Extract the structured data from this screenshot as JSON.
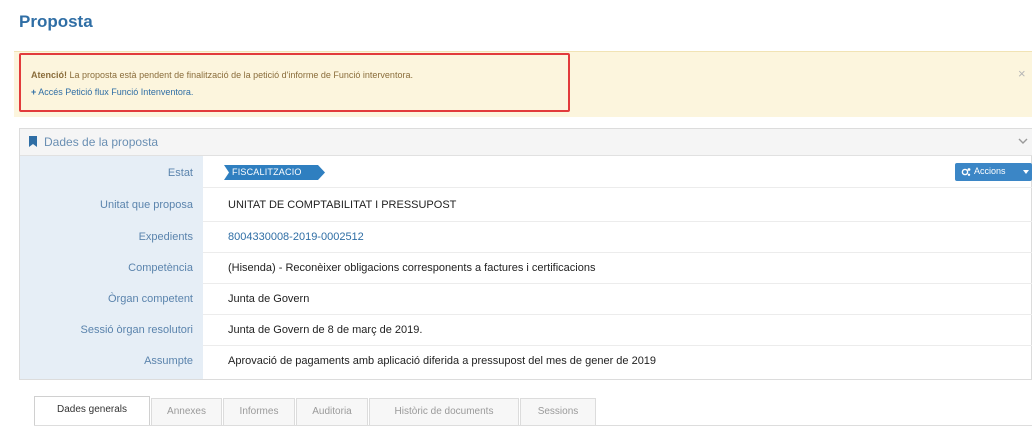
{
  "page": {
    "title": "Proposta"
  },
  "alert": {
    "strong": "Atenció!",
    "message": "La proposta està pendent de finalització de la petició d'informe de Funció interventora.",
    "link_label": "Accés Petició flux Funció Intenventora.",
    "close_glyph": "×"
  },
  "panel": {
    "title": "Dades de la proposta",
    "rows": [
      {
        "label": "Estat",
        "value": "FISCALITZACIO"
      },
      {
        "label": "Unitat que proposa",
        "value": "UNITAT DE COMPTABILITAT I PRESSUPOST"
      },
      {
        "label": "Expedients",
        "value": "8004330008-2019-0002512"
      },
      {
        "label": "Competència",
        "value": "(Hisenda) - Reconèixer obligacions corresponents a factures i certificacions"
      },
      {
        "label": "Òrgan competent",
        "value": "Junta de Govern"
      },
      {
        "label": "Sessió òrgan resolutori",
        "value": "Junta de Govern de 8 de març de 2019."
      },
      {
        "label": "Assumpte",
        "value": "Aprovació de pagaments amb aplicació diferida a pressupost del mes de gener de 2019"
      }
    ],
    "actions_label": "Accions"
  },
  "tabs": [
    {
      "label": "Dades generals",
      "active": true
    },
    {
      "label": "Annexes",
      "active": false
    },
    {
      "label": "Informes",
      "active": false
    },
    {
      "label": "Auditoria",
      "active": false
    },
    {
      "label": "Històric de documents",
      "active": false
    },
    {
      "label": "Sessions",
      "active": false
    }
  ],
  "colors": {
    "accent": "#2f6ea5",
    "alert_bg": "#fcf5dd",
    "highlight_border": "#e23b3b",
    "label_col_bg": "#e6eef6",
    "button_bg": "#3b86c6"
  },
  "icons": {
    "panel": "bookmark-icon",
    "collapse": "chevron-down-icon",
    "alert_link": "plus-icon",
    "actions": "gears-icon",
    "actions_caret": "caret-down-icon",
    "close": "close-icon"
  }
}
